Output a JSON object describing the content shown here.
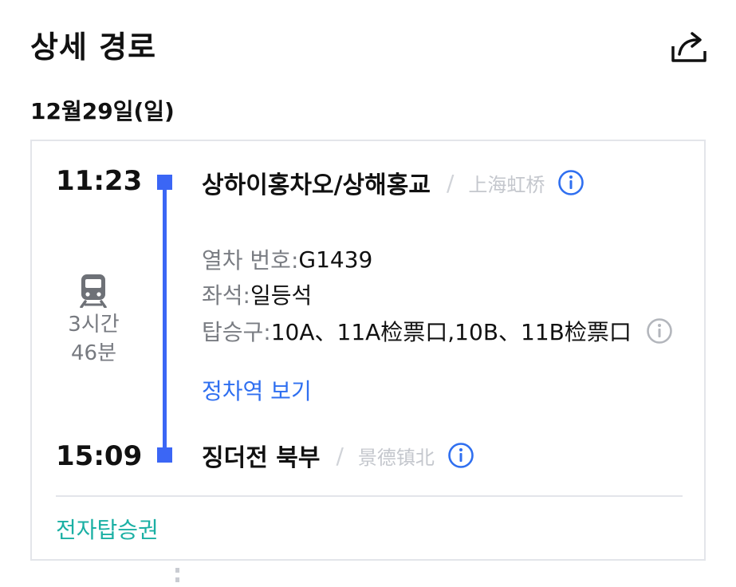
{
  "header": {
    "title": "상세 경로",
    "share_icon": "share-icon"
  },
  "date": "12월29일(일)",
  "segment": {
    "departure": {
      "time": "11:23",
      "station": "상하이홍차오/상해홍교",
      "local_name": "上海虹桥"
    },
    "arrival": {
      "time": "15:09",
      "station": "징더전 북부",
      "local_name": "景德镇北"
    },
    "duration": {
      "line1": "3시간",
      "line2": "46분"
    },
    "train_number": {
      "label": "열차 번호: ",
      "value": "G1439"
    },
    "seat": {
      "label": "좌석: ",
      "value": "일등석"
    },
    "gate": {
      "label": "탑승구: ",
      "value": "10A、11A检票口,10B、11B检票口"
    },
    "stops_link": "정차역 보기",
    "separator": "/"
  },
  "eticket_link": "전자탑승권",
  "colors": {
    "accent_blue": "#3b66f5",
    "link_blue": "#2f6ff0",
    "teal": "#1bb0a4",
    "muted_gray": "#7a7d83"
  },
  "icons": {
    "train": "train-icon",
    "info": "info-icon"
  }
}
